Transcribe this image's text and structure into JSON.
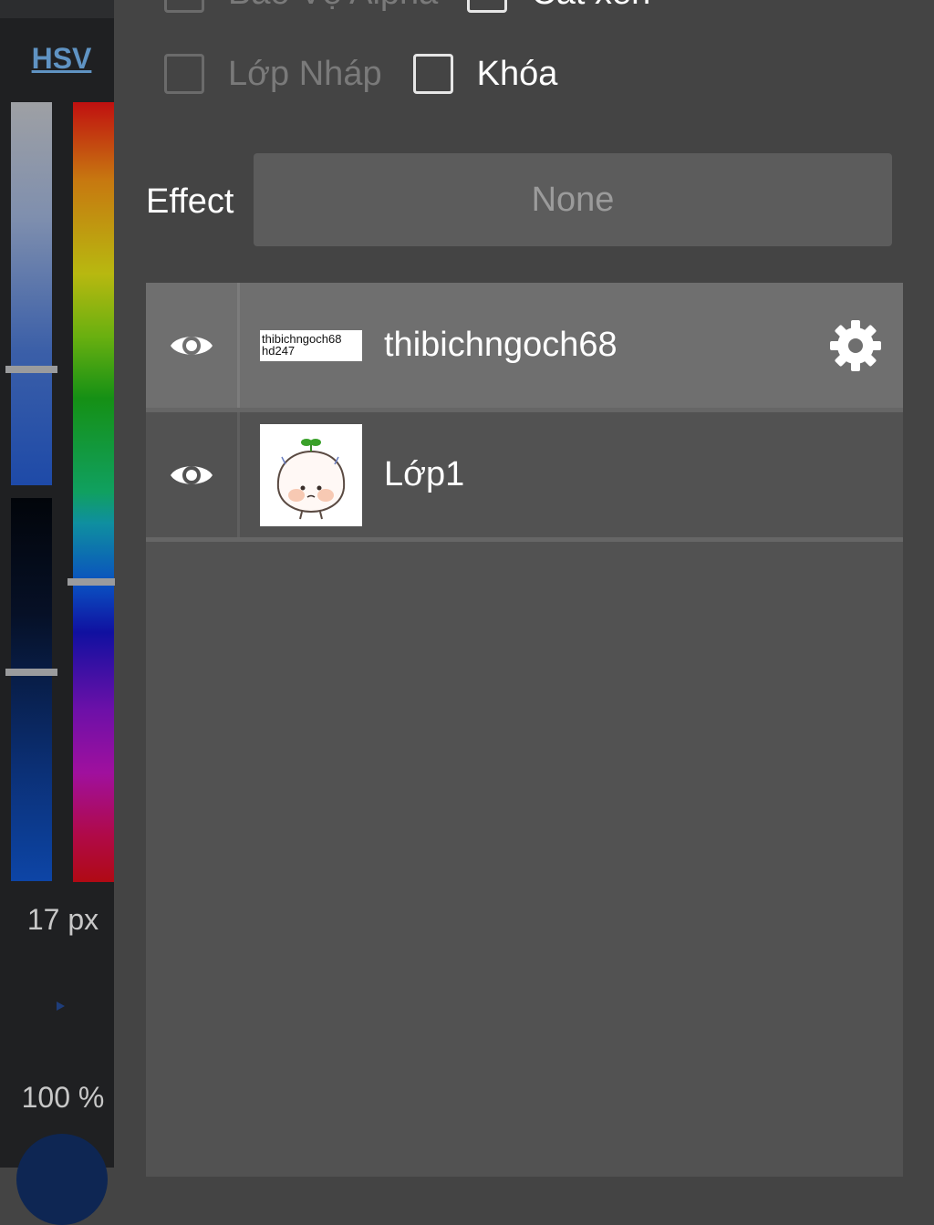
{
  "color_panel": {
    "mode_label": "HSV",
    "brush_size": "17 px",
    "opacity": "100 %"
  },
  "options": {
    "partial_row": [
      {
        "label": "Bảo Vệ Alpha",
        "checked": false,
        "enabled": false
      },
      {
        "label": "Cắt xén",
        "checked": false,
        "enabled": true
      }
    ],
    "main_row": [
      {
        "label": "Lớp Nháp",
        "checked": false,
        "enabled": false
      },
      {
        "label": "Khóa",
        "checked": false,
        "enabled": true
      }
    ]
  },
  "effect": {
    "label": "Effect",
    "value": "None"
  },
  "layers": [
    {
      "name": "thibichngoch68",
      "thumbnail_text": "thibichngoch68 hd247",
      "visible": true,
      "selected": true
    },
    {
      "name": "Lớp1",
      "visible": true,
      "selected": false
    }
  ],
  "icons": {
    "visibility": "eye-icon",
    "settings": "gear-icon"
  }
}
